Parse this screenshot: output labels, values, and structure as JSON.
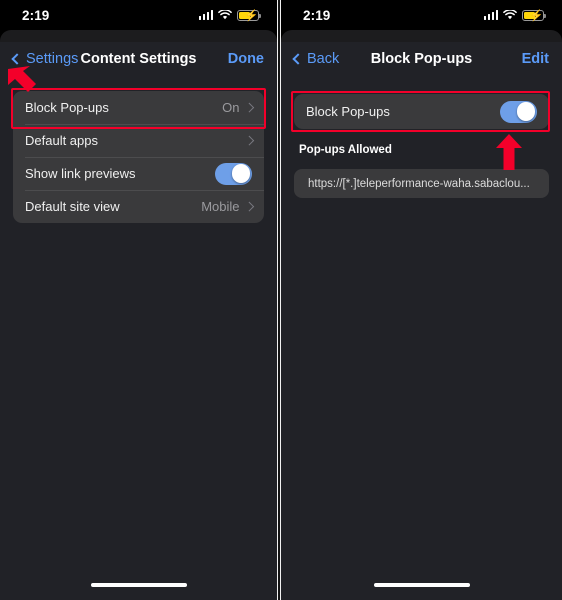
{
  "meta": {
    "accent_blue": "#5b9bf8",
    "highlight_red": "#f3002a",
    "toggle_on_color": "#6e9fe8",
    "row_bg": "#3a3a3c",
    "page_bg": "#212227"
  },
  "left_panel": {
    "status_bar": {
      "time": "2:19",
      "signal_icon": "cellular-signal-icon",
      "wifi_icon": "wifi-icon",
      "battery_icon": "battery-charging-icon"
    },
    "nav": {
      "back_label": "Settings",
      "back_icon": "chevron-left-icon",
      "title": "Content Settings",
      "action_label": "Done"
    },
    "list": [
      {
        "label": "Block Pop-ups",
        "value": "On",
        "type": "disclosure",
        "highlighted": true
      },
      {
        "label": "Default apps",
        "value": "",
        "type": "disclosure",
        "highlighted": false
      },
      {
        "label": "Show link previews",
        "value": "",
        "type": "toggle",
        "toggle_on": true
      },
      {
        "label": "Default site view",
        "value": "Mobile",
        "type": "disclosure",
        "highlighted": false
      }
    ],
    "annotation_arrow": "red-arrow-down-right"
  },
  "right_panel": {
    "status_bar": {
      "time": "2:19",
      "signal_icon": "cellular-signal-icon",
      "wifi_icon": "wifi-icon",
      "battery_icon": "battery-charging-icon"
    },
    "nav": {
      "back_label": "Back",
      "back_icon": "chevron-left-icon",
      "title": "Block Pop-ups",
      "action_label": "Edit"
    },
    "toggle_row": {
      "label": "Block Pop-ups",
      "toggle_on": true
    },
    "section_header": "Pop-ups Allowed",
    "allowed_sites": [
      {
        "url": "https://[*.]teleperformance-waha.sabaclou..."
      }
    ],
    "annotation_arrow": "red-arrow-up"
  }
}
